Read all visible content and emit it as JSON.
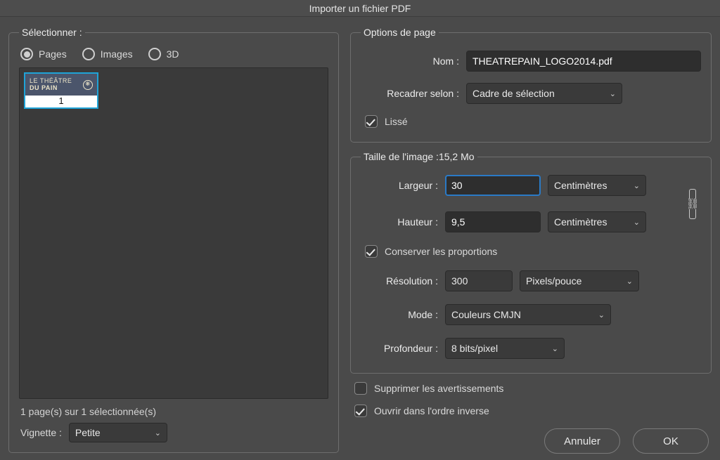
{
  "window": {
    "title": "Importer un fichier PDF"
  },
  "left": {
    "legend": "Sélectionner :",
    "radios": {
      "pages": "Pages",
      "images": "Images",
      "threeD": "3D"
    },
    "thumb": {
      "logo_line1": "LE THÉÂTRE",
      "logo_line2": "DU PAIN",
      "page_num": "1"
    },
    "status": "1 page(s) sur 1 sélectionnée(s)",
    "vignette_label": "Vignette :",
    "vignette_value": "Petite"
  },
  "options": {
    "legend": "Options de page",
    "name_label": "Nom :",
    "name_value": "THEATREPAIN_LOGO2014.pdf",
    "crop_label": "Recadrer selon :",
    "crop_value": "Cadre de sélection",
    "smooth_label": "Lissé"
  },
  "size": {
    "legend_prefix": "Taille de l'image :",
    "size_value": "15,2 Mo",
    "width_label": "Largeur :",
    "width_value": "30",
    "height_label": "Hauteur :",
    "height_value": "9,5",
    "unit_value": "Centimètres",
    "keep_ratio": "Conserver les proportions",
    "res_label": "Résolution :",
    "res_value": "300",
    "res_unit": "Pixels/pouce",
    "mode_label": "Mode :",
    "mode_value": "Couleurs CMJN",
    "depth_label": "Profondeur :",
    "depth_value": "8 bits/pixel"
  },
  "bottom": {
    "suppress": "Supprimer les avertissements",
    "reverse": "Ouvrir dans l'ordre inverse"
  },
  "buttons": {
    "cancel": "Annuler",
    "ok": "OK"
  },
  "icons": {
    "link": "⛓"
  }
}
